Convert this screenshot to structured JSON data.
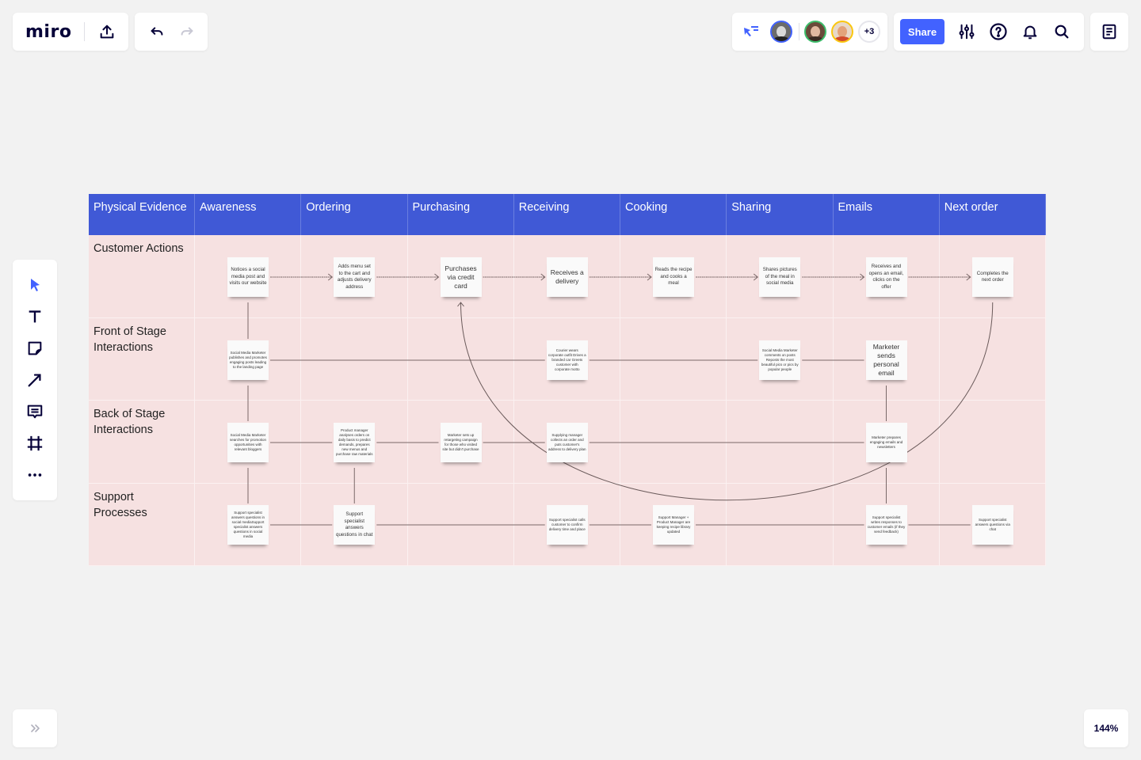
{
  "app": {
    "logo": "miro",
    "zoom_level": "144%",
    "share_label": "Share",
    "extra_collaborators": "+3",
    "icons": {
      "upload": "upload-icon",
      "undo": "undo-icon",
      "redo": "redo-icon",
      "cursor_follow": "cursor-follow-icon",
      "settings": "sliders-icon",
      "help": "help-icon",
      "notifications": "bell-icon",
      "search": "search-icon",
      "notes": "notes-icon",
      "expand": "double-chevron-right-icon"
    },
    "collaborators": [
      {
        "name": "collaborator-1",
        "ring": "#4262ff"
      },
      {
        "name": "collaborator-2",
        "ring": "#3dbd6b"
      },
      {
        "name": "collaborator-3",
        "ring": "#fac710"
      }
    ],
    "accent": "#4262ff"
  },
  "toolbar": {
    "tools": [
      {
        "name": "select-tool",
        "icon": "cursor-icon"
      },
      {
        "name": "text-tool",
        "icon": "text-icon"
      },
      {
        "name": "sticky-note-tool",
        "icon": "sticky-note-icon"
      },
      {
        "name": "connection-line-tool",
        "icon": "arrow-icon"
      },
      {
        "name": "comment-tool",
        "icon": "comment-icon"
      },
      {
        "name": "frame-tool",
        "icon": "frame-icon"
      },
      {
        "name": "more-tools",
        "icon": "more-icon"
      }
    ]
  },
  "board": {
    "header_color": "#4059d6",
    "cell_color": "#f6e1e1",
    "corner_label": "Physical Evidence",
    "columns": [
      "Awareness",
      "Ordering",
      "Purchasing",
      "Receiving",
      "Cooking",
      "Sharing",
      "Emails",
      "Next order"
    ],
    "rows": [
      "Customer Actions",
      "Front of Stage Interactions",
      "Back of Stage Interactions",
      "Support Processes"
    ],
    "stickies": {
      "customer_actions": [
        {
          "col": 0,
          "text": "Notices a social media post and visits our website",
          "size": "sm"
        },
        {
          "col": 1,
          "text": "Adds menu set to the cart and adjusts delivery address",
          "size": "sm"
        },
        {
          "col": 2,
          "text": "Purchases via credit card",
          "size": "md"
        },
        {
          "col": 3,
          "text": "Receives a delivery",
          "size": "md"
        },
        {
          "col": 4,
          "text": "Reads the recipe and cooks a meal",
          "size": "sm"
        },
        {
          "col": 5,
          "text": "Shares pictures of the meal in social media",
          "size": "sm"
        },
        {
          "col": 6,
          "text": "Receives and opens an email, clicks on the offer",
          "size": "sm"
        },
        {
          "col": 7,
          "text": "Completes the next order",
          "size": "sm"
        }
      ],
      "front_stage": [
        {
          "col": 0,
          "text": "Social Media Marketer publishes and promotes engaging posts leading to the landing page",
          "size": "xs"
        },
        {
          "col": 3,
          "text": "Courier wears corporate outfit Drives a branded car Greets customer with corporate motto",
          "size": "xs"
        },
        {
          "col": 5,
          "text": "Social Media Marketer comments on posts Reposts the most beautiful pics or pics by popular people",
          "size": "xs"
        },
        {
          "col": 6,
          "text": "Marketer sends personal email",
          "size": "md"
        }
      ],
      "back_stage": [
        {
          "col": 0,
          "text": "Social Media Marketer searches for promotion opportunities with relevant bloggers",
          "size": "xs"
        },
        {
          "col": 1,
          "text": "Product manager analyses orders on daily basis to predict demands, prepares new menus and purchase raw materials",
          "size": "xs"
        },
        {
          "col": 2,
          "text": "Marketer sets up retargeting campaign for those who visited site but didn't purchase",
          "size": "xs"
        },
        {
          "col": 3,
          "text": "Supplying manager collects an order and puts customer's address to delivery plan",
          "size": "xs"
        },
        {
          "col": 6,
          "text": "Marketer prepares engaging emails and newsletters",
          "size": "xs"
        }
      ],
      "support": [
        {
          "col": 0,
          "text": "Support specialist answers questions in social mediaSupport specialist answers questions in social media",
          "size": "xs"
        },
        {
          "col": 1,
          "text": "Support specialist answers questions in chat",
          "size": "sm"
        },
        {
          "col": 3,
          "text": "Support specialist calls customer to confirm delivery time and place",
          "size": "xs"
        },
        {
          "col": 4,
          "text": "Support Manager + Product Manager are keeping recipe library updated",
          "size": "xs"
        },
        {
          "col": 6,
          "text": "Support specialist writes responses to customer emails (if they send feedback)",
          "size": "xs"
        },
        {
          "col": 7,
          "text": "Support specialist answers questions via chat",
          "size": "xs"
        }
      ]
    }
  }
}
